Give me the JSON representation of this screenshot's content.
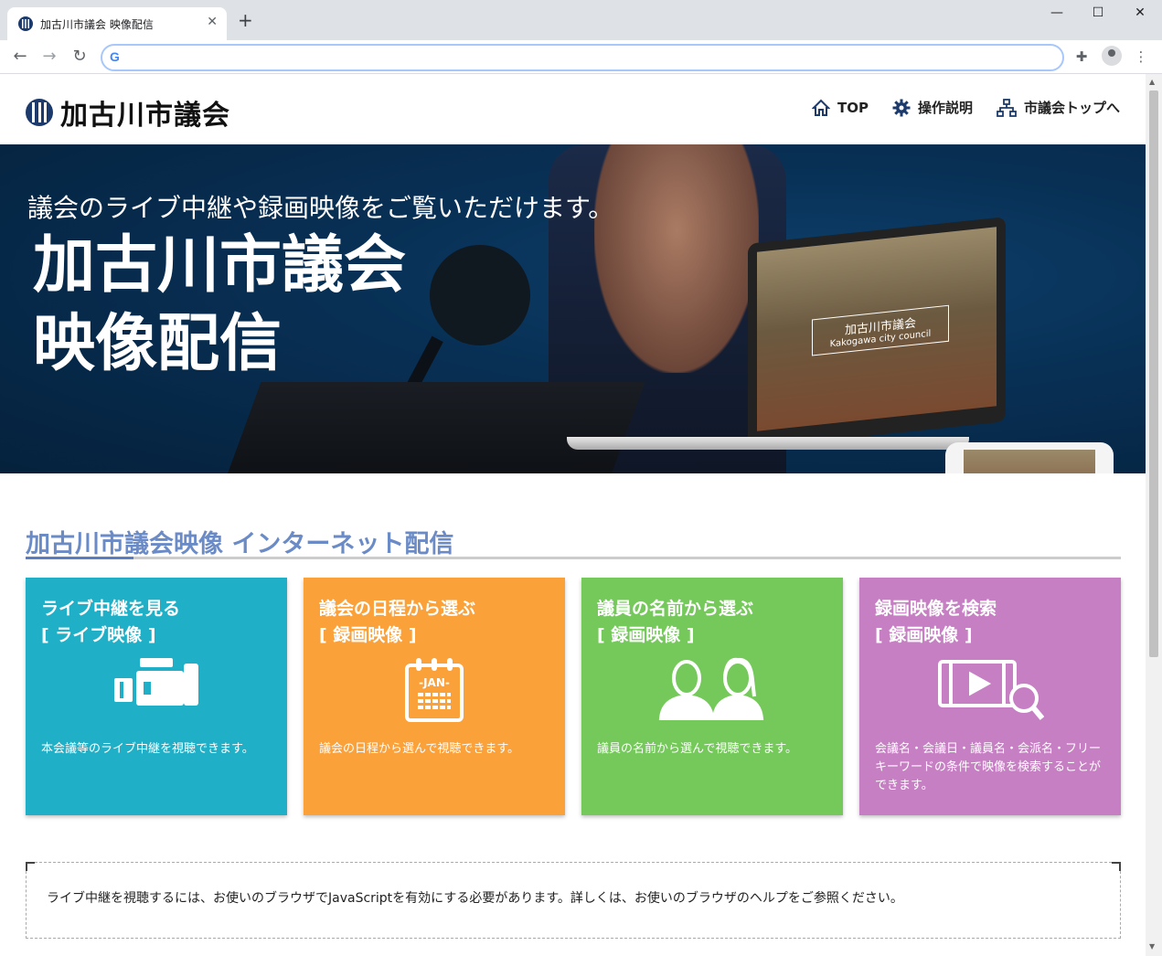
{
  "browser": {
    "tab_title": "加古川市議会 映像配信",
    "tab_close": "✕",
    "new_tab": "+",
    "omnibox_value": "",
    "window_controls": {
      "minimize": "—",
      "maximize": "☐",
      "close": "✕"
    }
  },
  "header": {
    "logo_text": "加古川市議会",
    "nav": [
      {
        "label": "TOP",
        "icon": "home-icon"
      },
      {
        "label": "操作説明",
        "icon": "gear-icon"
      },
      {
        "label": "市議会トップへ",
        "icon": "sitemap-icon"
      }
    ]
  },
  "hero": {
    "tagline": "議会のライブ中継や録画映像をご覧いただけます。",
    "title_line1": "加古川市議会",
    "title_line2": "映像配信",
    "laptop_caption_ja": "加古川市議会",
    "laptop_caption_en": "Kakogawa city council"
  },
  "section": {
    "title": "加古川市議会映像 インターネット配信"
  },
  "cards": [
    {
      "title_line1": "ライブ中継を見る",
      "title_line2": "[ ライブ映像 ]",
      "icon": "video-camera-icon",
      "color": "#1fb0c8",
      "description": "本会議等のライブ中継を視聴できます。"
    },
    {
      "title_line1": "議会の日程から選ぶ",
      "title_line2": "[ 録画映像 ]",
      "icon": "calendar-icon",
      "calendar_label": "-JAN-",
      "color": "#fba13a",
      "description": "議会の日程から選んで視聴できます。"
    },
    {
      "title_line1": "議員の名前から選ぶ",
      "title_line2": "[ 録画映像 ]",
      "icon": "members-icon",
      "color": "#74c95a",
      "description": "議員の名前から選んで視聴できます。"
    },
    {
      "title_line1": "録画映像を検索",
      "title_line2": "[ 録画映像 ]",
      "icon": "video-search-icon",
      "color": "#c77fc4",
      "description": "会議名・会議日・議員名・会派名・フリーキーワードの条件で映像を検索することができます。"
    }
  ],
  "notice": {
    "text": "ライブ中継を視聴するには、お使いのブラウザでJavaScriptを有効にする必要があります。詳しくは、お使いのブラウザのヘルプをご参照ください。"
  }
}
